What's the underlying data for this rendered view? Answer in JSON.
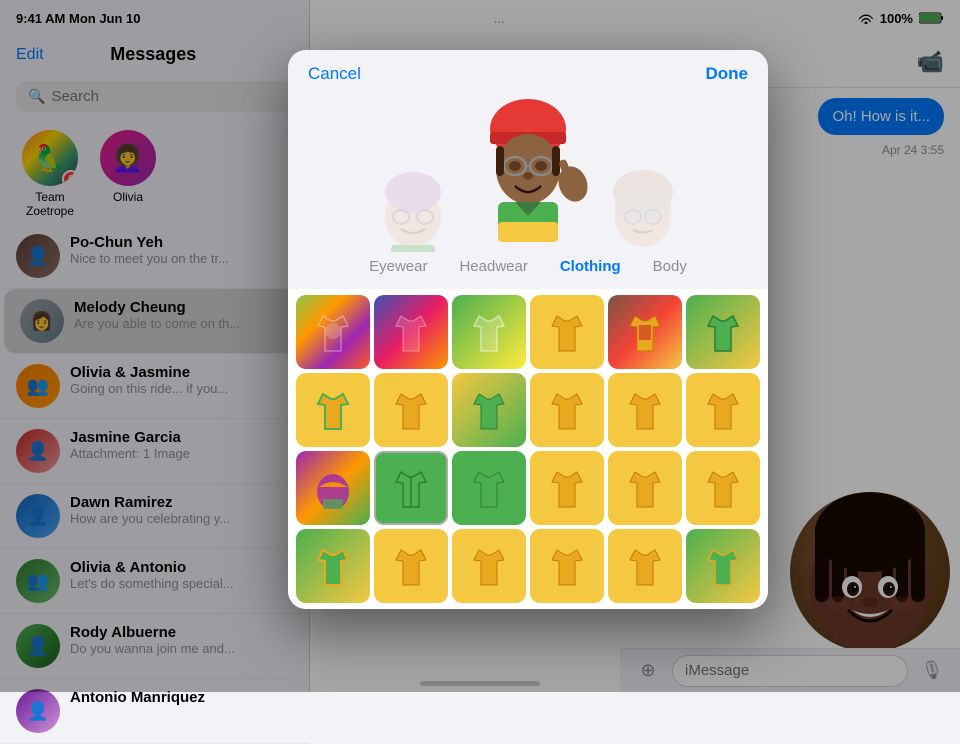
{
  "statusBar": {
    "time": "9:41 AM",
    "day": "Mon Jun 10",
    "wifi": "WiFi",
    "battery": "100%",
    "dots": "..."
  },
  "sidebar": {
    "editLabel": "Edit",
    "title": "Messages",
    "searchPlaceholder": "Search",
    "pinnedContacts": [
      {
        "name": "Team Zoetrope",
        "emoji": "🦜"
      },
      {
        "name": "Olivia",
        "emoji": "👩‍🦱"
      }
    ],
    "messages": [
      {
        "name": "Po-Chun Yeh",
        "preview": "Nice to meet you on the tr...",
        "avatarClass": "av-pochun",
        "emoji": "👤"
      },
      {
        "name": "Melody Cheung",
        "preview": "Are you able to come on th...",
        "avatarClass": "av-melody",
        "emoji": "👤",
        "selected": true
      },
      {
        "name": "Olivia & Jasmine",
        "preview": "Going on this ride... if you...",
        "avatarClass": "av-oliviaj",
        "emoji": "👤"
      },
      {
        "name": "Jasmine Garcia",
        "preview": "Attachment: 1 Image",
        "avatarClass": "av-jasmine",
        "emoji": "👤"
      },
      {
        "name": "Dawn Ramirez",
        "preview": "How are you celebrating y...",
        "avatarClass": "av-dawn",
        "emoji": "👤"
      },
      {
        "name": "Olivia & Antonio",
        "preview": "Let's do something special...",
        "avatarClass": "av-oliviaa",
        "emoji": "👤"
      },
      {
        "name": "Rody Albuerne",
        "preview": "Do you wanna join me and...",
        "avatarClass": "av-rody",
        "emoji": "👤"
      },
      {
        "name": "Antonio Manriquez",
        "preview": "",
        "avatarClass": "av-antonio",
        "emoji": "👤"
      }
    ]
  },
  "chatArea": {
    "videoBtnLabel": "📹",
    "bubble1": "Oh! How is it...",
    "bubble2": "Apr 24 3:55"
  },
  "modal": {
    "cancelLabel": "Cancel",
    "doneLabel": "Done",
    "tabs": [
      {
        "id": "eyewear",
        "label": "Eyewear"
      },
      {
        "id": "headwear",
        "label": "Headwear"
      },
      {
        "id": "clothing",
        "label": "Clothing"
      },
      {
        "id": "body",
        "label": "Body"
      }
    ],
    "activeTab": "clothing",
    "clothingRows": [
      [
        "row1-1",
        "row1-2",
        "row1-3",
        "row1-4",
        "row1-5",
        "row1-6"
      ],
      [
        "row2-1",
        "row2-2",
        "row2-3",
        "row2-4",
        "row2-5",
        "row2-6"
      ],
      [
        "row3-1",
        "row3-2",
        "row3-3",
        "row3-4",
        "row3-5",
        "row3-6"
      ],
      [
        "row4-1",
        "row4-2",
        "row4-3",
        "row4-4",
        "row4-5",
        "row4-6"
      ]
    ],
    "selectedItem": "row3-2"
  },
  "inputBar": {
    "placeholder": "iMessage",
    "micIcon": "🎙"
  }
}
